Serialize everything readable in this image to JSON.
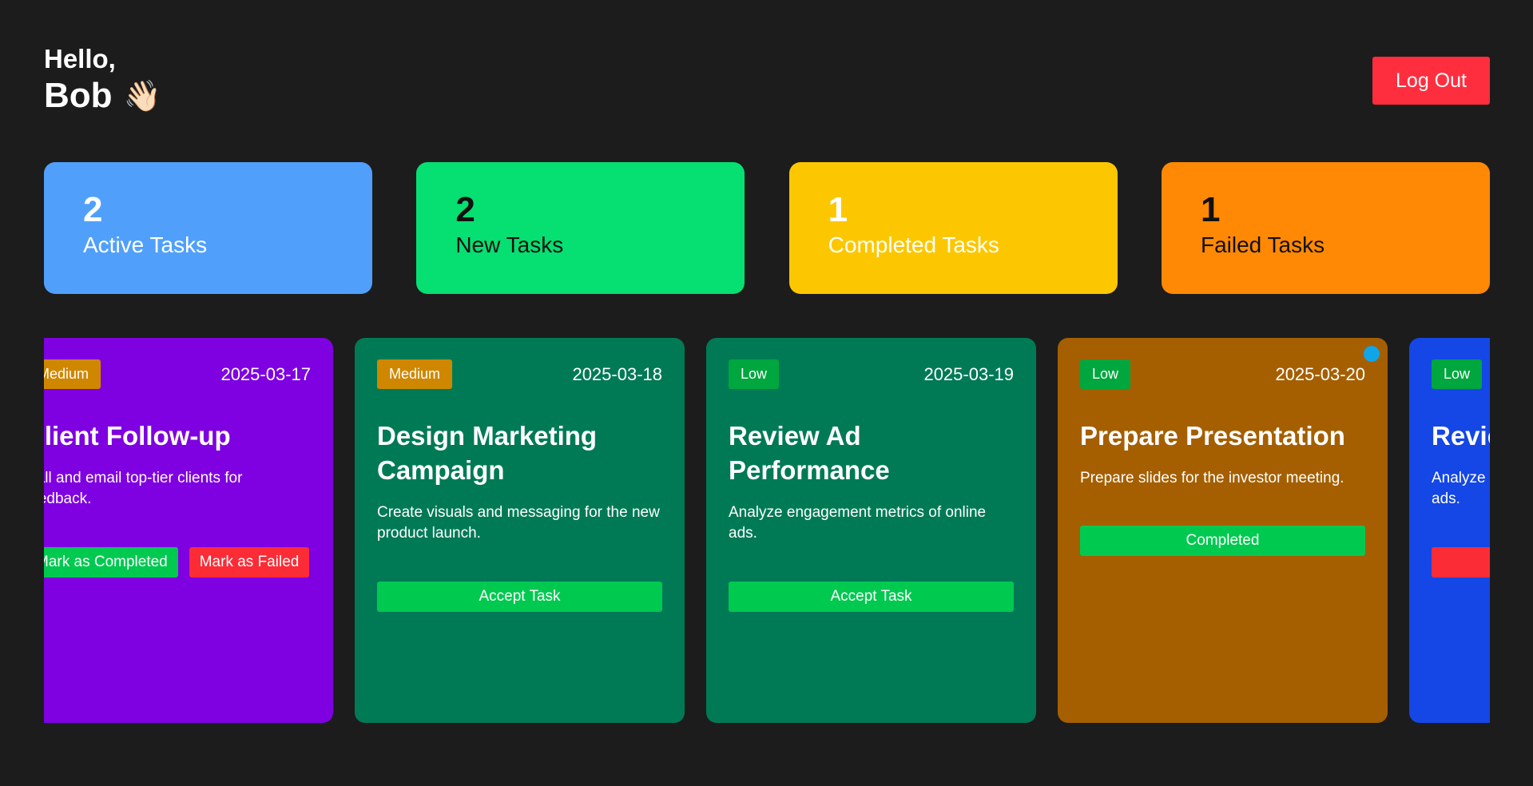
{
  "header": {
    "hello": "Hello,",
    "name": "Bob",
    "wave": "👋🏻",
    "logout_label": "Log Out"
  },
  "stats": [
    {
      "count": "2",
      "label": "Active Tasks",
      "color": "#50a0fb"
    },
    {
      "count": "2",
      "label": "New Tasks",
      "color": "#06df72"
    },
    {
      "count": "1",
      "label": "Completed Tasks",
      "color": "#fdc700"
    },
    {
      "count": "1",
      "label": "Failed Tasks",
      "color": "#ff8904"
    }
  ],
  "tasks": [
    {
      "priority": "Medium",
      "date": "2025-03-17",
      "title": "Client Follow-up",
      "description": "Call and email top-tier clients for feedback.",
      "actions": [
        "Mark as Completed",
        "Mark as Failed"
      ]
    },
    {
      "priority": "Medium",
      "date": "2025-03-18",
      "title": "Design Marketing Campaign",
      "description": "Create visuals and messaging for the new product launch.",
      "actions": [
        "Accept Task"
      ]
    },
    {
      "priority": "Low",
      "date": "2025-03-19",
      "title": "Review Ad Performance",
      "description": "Analyze engagement metrics of online ads.",
      "actions": [
        "Accept Task"
      ]
    },
    {
      "priority": "Low",
      "date": "2025-03-20",
      "title": "Prepare Presentation",
      "description": "Prepare slides for the investor meeting.",
      "actions": [
        "Completed"
      ]
    },
    {
      "priority": "Low",
      "date": "",
      "title": "Revie",
      "description": "Analyze ads.",
      "actions": [
        ""
      ]
    }
  ],
  "colors": {
    "background": "#1c1c1c",
    "logout": "#ff2e3f",
    "card_purple": "#7f00e0",
    "card_teal": "#007a55",
    "card_brown": "#a55f00",
    "card_blue": "#1447e6",
    "badge_medium": "#d08700",
    "badge_low": "#00a63e",
    "btn_green": "#00c950",
    "btn_red": "#fb2c36",
    "dot": "#0ea5e9"
  }
}
